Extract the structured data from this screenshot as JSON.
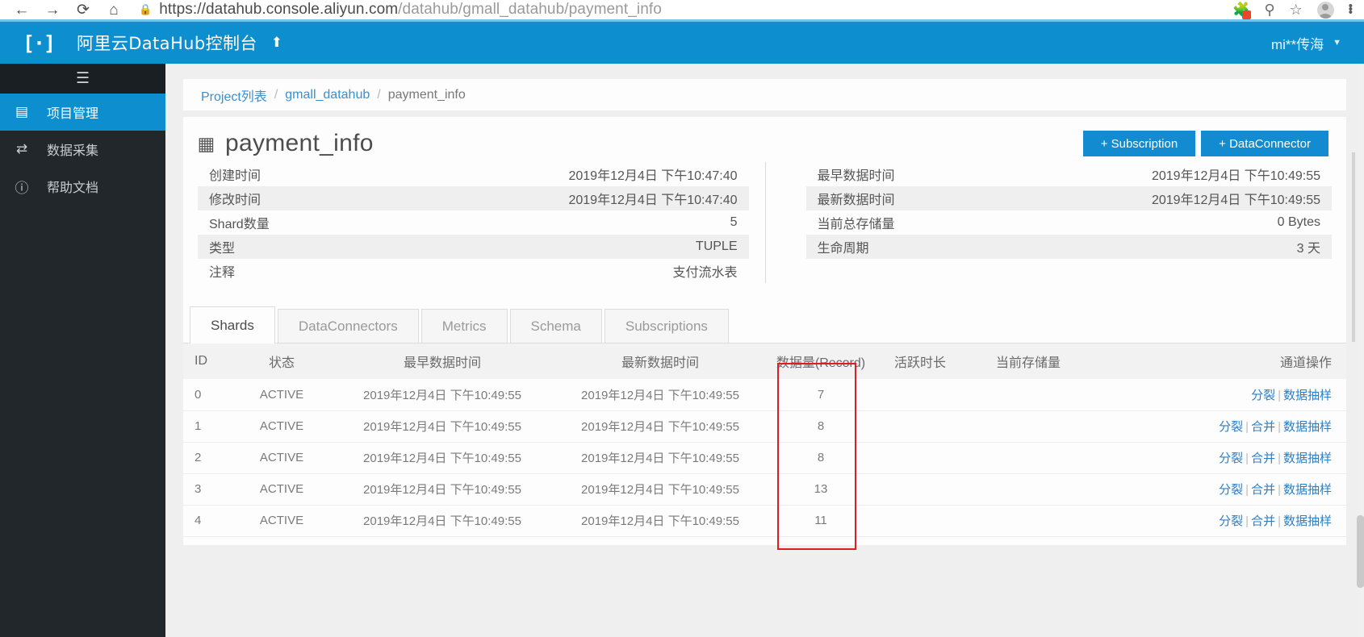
{
  "browser": {
    "url_prefix": "https://datahub.console.aliyun.com",
    "url_path": "/datahub/gmall_datahub/payment_info",
    "nav": {
      "back": "←",
      "forward": "→",
      "reload": "⟳",
      "home": "⌂",
      "lock_icon": "🔒"
    },
    "toolbar": {
      "extension_icon": "puzzle-icon",
      "zoom_out_icon": "⊖",
      "bookmark_icon": "☆",
      "profile_icon": "avatar",
      "menu_icon": "⋮"
    }
  },
  "header": {
    "logo": "[·]",
    "title": "阿里云DataHub控制台",
    "pin_icon": "⬆",
    "user": "mi**传海",
    "caret": "▼"
  },
  "sidebar": {
    "hamburger": "☰",
    "items": [
      {
        "label": "项目管理",
        "icon": "▤",
        "active": true
      },
      {
        "label": "数据采集",
        "icon": "⇄",
        "active": false
      },
      {
        "label": "帮助文档",
        "icon": "?",
        "active": false
      }
    ]
  },
  "breadcrumb": {
    "items": [
      "Project列表",
      "gmall_datahub",
      "payment_info"
    ],
    "separator": "/"
  },
  "topic": {
    "icon": "table-icon",
    "name": "payment_info",
    "actions": [
      {
        "label": "+ Subscription"
      },
      {
        "label": "+ DataConnector"
      }
    ],
    "info_left": [
      {
        "key": "创建时间",
        "value": "2019年12月4日 下午10:47:40"
      },
      {
        "key": "修改时间",
        "value": "2019年12月4日 下午10:47:40"
      },
      {
        "key": "Shard数量",
        "value": "5"
      },
      {
        "key": "类型",
        "value": "TUPLE"
      },
      {
        "key": "注释",
        "value": "支付流水表"
      }
    ],
    "info_right": [
      {
        "key": "最早数据时间",
        "value": "2019年12月4日 下午10:49:55"
      },
      {
        "key": "最新数据时间",
        "value": "2019年12月4日 下午10:49:55"
      },
      {
        "key": "当前总存储量",
        "value": "0 Bytes"
      },
      {
        "key": "生命周期",
        "value": "3 天"
      }
    ]
  },
  "tabs": [
    {
      "label": "Shards",
      "active": true
    },
    {
      "label": "DataConnectors",
      "active": false
    },
    {
      "label": "Metrics",
      "active": false
    },
    {
      "label": "Schema",
      "active": false
    },
    {
      "label": "Subscriptions",
      "active": false
    }
  ],
  "shards_table": {
    "columns": [
      "ID",
      "状态",
      "最早数据时间",
      "最新数据时间",
      "数据量(Record)",
      "活跃时长",
      "当前存储量",
      "通道操作"
    ],
    "rows": [
      {
        "id": "0",
        "state": "ACTIVE",
        "earliest": "2019年12月4日 下午10:49:55",
        "latest": "2019年12月4日 下午10:49:55",
        "records": "7",
        "active_time": "",
        "storage": "",
        "ops": [
          "分裂",
          "数据抽样"
        ]
      },
      {
        "id": "1",
        "state": "ACTIVE",
        "earliest": "2019年12月4日 下午10:49:55",
        "latest": "2019年12月4日 下午10:49:55",
        "records": "8",
        "active_time": "",
        "storage": "",
        "ops": [
          "分裂",
          "合并",
          "数据抽样"
        ]
      },
      {
        "id": "2",
        "state": "ACTIVE",
        "earliest": "2019年12月4日 下午10:49:55",
        "latest": "2019年12月4日 下午10:49:55",
        "records": "8",
        "active_time": "",
        "storage": "",
        "ops": [
          "分裂",
          "合并",
          "数据抽样"
        ]
      },
      {
        "id": "3",
        "state": "ACTIVE",
        "earliest": "2019年12月4日 下午10:49:55",
        "latest": "2019年12月4日 下午10:49:55",
        "records": "13",
        "active_time": "",
        "storage": "",
        "ops": [
          "分裂",
          "合并",
          "数据抽样"
        ]
      },
      {
        "id": "4",
        "state": "ACTIVE",
        "earliest": "2019年12月4日 下午10:49:55",
        "latest": "2019年12月4日 下午10:49:55",
        "records": "11",
        "active_time": "",
        "storage": "",
        "ops": [
          "分裂",
          "合并",
          "数据抽样"
        ]
      }
    ],
    "ops_separator": "|"
  },
  "annotation": {
    "highlight_column": "数据量(Record)",
    "color": "#e01b24"
  }
}
